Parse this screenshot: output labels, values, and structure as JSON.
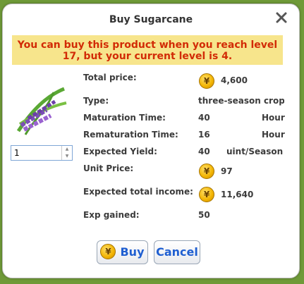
{
  "dialog": {
    "title": "Buy Sugarcane",
    "warning": "You can buy this product when you reach level 17, but your current level is 4.",
    "quantity": "1"
  },
  "details": {
    "total_price_label": "Total price:",
    "total_price": "4,600",
    "type_label": "Type:",
    "type": "three-season crop",
    "maturation_label": "Maturation Time:",
    "maturation_value": "40",
    "maturation_unit": "Hour",
    "rematuration_label": "Rematuration Time:",
    "rematuration_value": "16",
    "rematuration_unit": "Hour",
    "yield_label": "Expected Yield:",
    "yield_value": "40",
    "yield_unit": "uint/Season",
    "unit_price_label": "Unit Price:",
    "unit_price": "97",
    "income_label": "Expected total income:",
    "income": "11,640",
    "exp_label": "Exp gained:",
    "exp": "50"
  },
  "buttons": {
    "buy": "Buy",
    "cancel": "Cancel"
  },
  "icons": {
    "coin_symbol": "¥",
    "close": "close-icon"
  }
}
